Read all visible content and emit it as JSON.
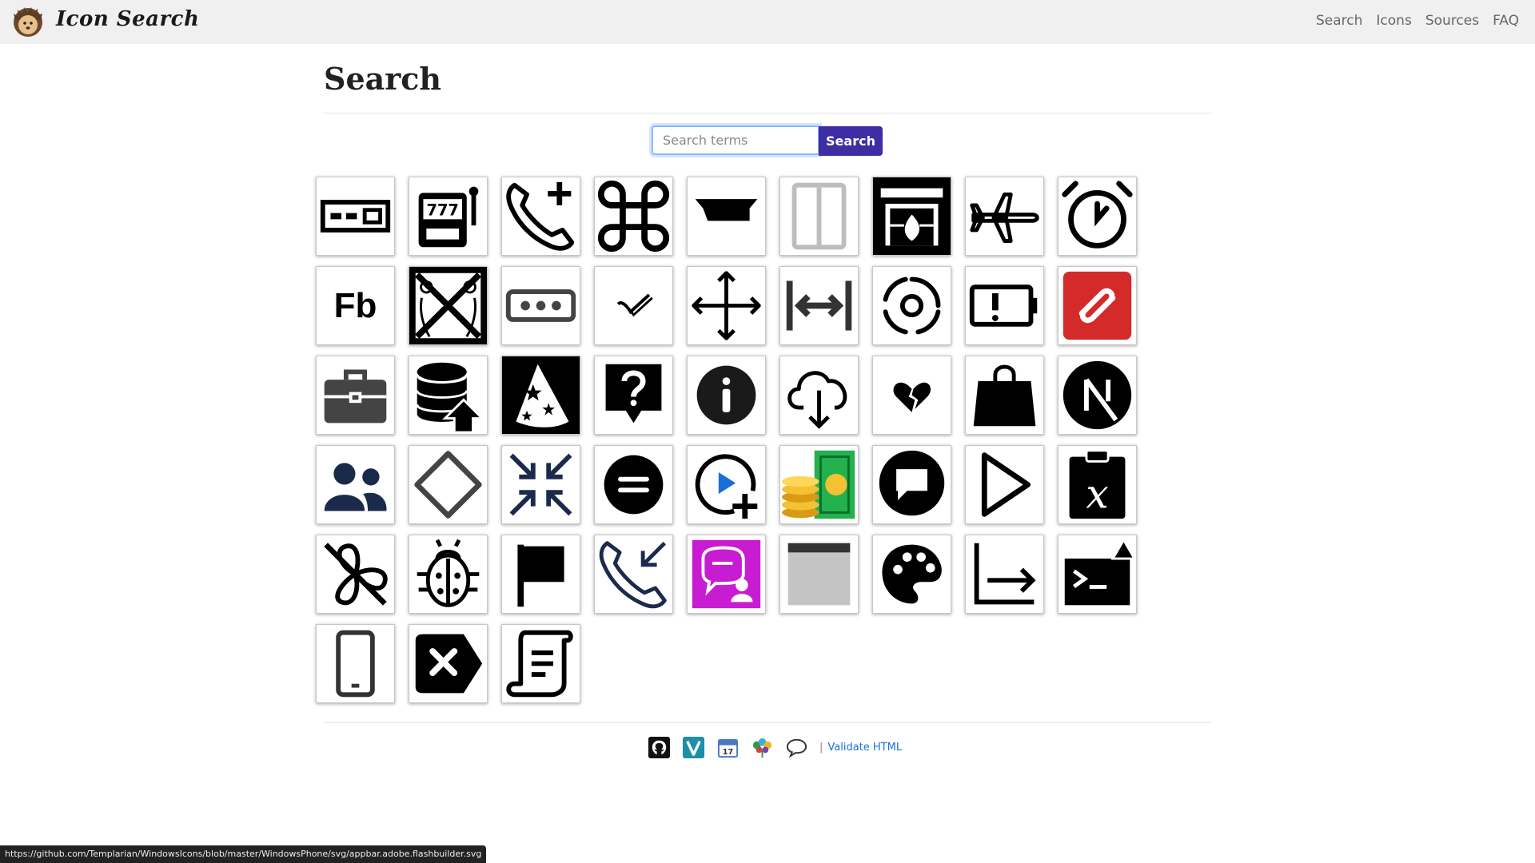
{
  "header": {
    "brand": "Icon Search",
    "nav": [
      "Search",
      "Icons",
      "Sources",
      "FAQ"
    ]
  },
  "page_title": "Search",
  "search": {
    "placeholder": "Search terms",
    "button_label": "Search"
  },
  "icons": [
    {
      "name": "dial-bars-icon"
    },
    {
      "name": "slot-machine-icon",
      "text": "777"
    },
    {
      "name": "phone-add-icon"
    },
    {
      "name": "command-key-icon"
    },
    {
      "name": "anvil-top-icon"
    },
    {
      "name": "split-panel-icon"
    },
    {
      "name": "fireplace-icon"
    },
    {
      "name": "airplane-icon"
    },
    {
      "name": "alarm-clock-icon"
    },
    {
      "name": "adobe-flashbuilder-icon",
      "text": "Fb"
    },
    {
      "name": "crossed-fencing-icon"
    },
    {
      "name": "password-dots-icon"
    },
    {
      "name": "small-checkmark-icon"
    },
    {
      "name": "move-arrows-icon"
    },
    {
      "name": "width-arrow-icon"
    },
    {
      "name": "orbit-target-icon"
    },
    {
      "name": "battery-alert-icon"
    },
    {
      "name": "authy-logo-icon"
    },
    {
      "name": "toolbox-icon"
    },
    {
      "name": "database-upload-icon"
    },
    {
      "name": "wizard-hat-icon"
    },
    {
      "name": "help-bubble-icon"
    },
    {
      "name": "info-circle-icon"
    },
    {
      "name": "cloud-download-icon"
    },
    {
      "name": "broken-heart-icon"
    },
    {
      "name": "shopping-bag-icon"
    },
    {
      "name": "nextjs-logo-icon"
    },
    {
      "name": "people-icon"
    },
    {
      "name": "diamond-icon"
    },
    {
      "name": "collapse-arrows-icon"
    },
    {
      "name": "equals-circle-icon"
    },
    {
      "name": "play-add-icon"
    },
    {
      "name": "coins-money-icon"
    },
    {
      "name": "chat-bubble-icon"
    },
    {
      "name": "play-triangle-icon"
    },
    {
      "name": "clipboard-variable-icon"
    },
    {
      "name": "fan-off-icon"
    },
    {
      "name": "ladybug-icon"
    },
    {
      "name": "flag-icon"
    },
    {
      "name": "phone-incoming-icon"
    },
    {
      "name": "chat-user-icon"
    },
    {
      "name": "browser-window-icon"
    },
    {
      "name": "palette-icon"
    },
    {
      "name": "chart-arrow-icon"
    },
    {
      "name": "terminal-alert-icon"
    },
    {
      "name": "mobile-phone-icon"
    },
    {
      "name": "delete-tag-icon"
    },
    {
      "name": "script-scroll-icon"
    }
  ],
  "footer": {
    "icons": [
      "github-icon",
      "v-logo-icon",
      "calendar-icon",
      "peacock-icon",
      "speech-bubble-icon"
    ],
    "calendar_day": "17",
    "separator": "|",
    "link": "Validate HTML"
  },
  "status_url": "https://github.com/Templarian/WindowsIcons/blob/master/WindowsPhone/svg/appbar.adobe.flashbuilder.svg",
  "colors": {
    "accent_button": "#3d2fa3",
    "authy_red": "#d42a2a",
    "chat_magenta": "#c81cd2",
    "link_blue": "#1a6fd6",
    "topbar": "#f0f0f0"
  }
}
